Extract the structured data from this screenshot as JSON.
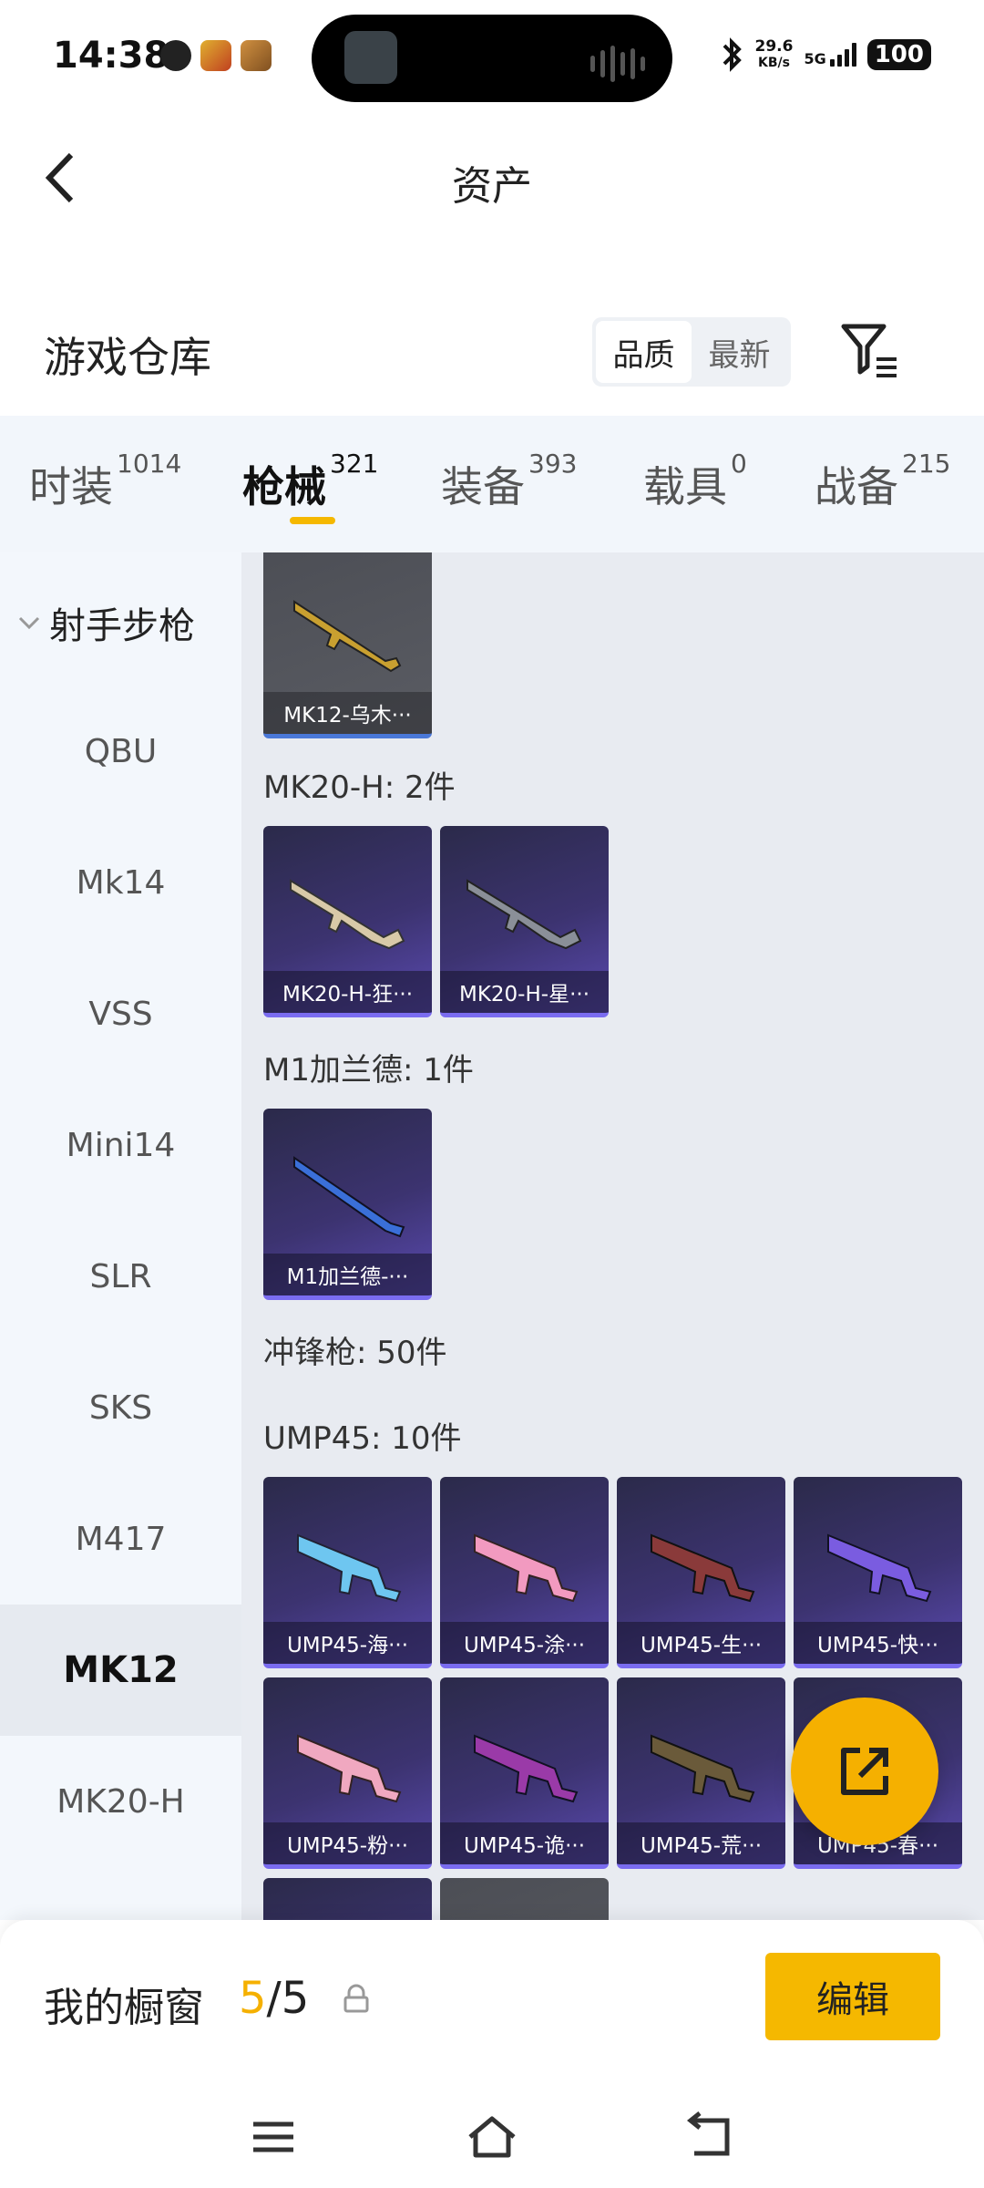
{
  "status_bar": {
    "time": "14:38",
    "net_speed_value": "29.6",
    "net_speed_unit": "KB/s",
    "network": "5G",
    "battery": "100"
  },
  "header": {
    "title": "资产",
    "back_icon": "chevron-left-icon"
  },
  "warehouse": {
    "title": "游戏仓库",
    "sort_options": [
      "品质",
      "最新"
    ],
    "sort_selected": "品质",
    "filter_icon": "filter-icon"
  },
  "tabs": [
    {
      "label": "时装",
      "count": "1014"
    },
    {
      "label": "枪械",
      "count": "321",
      "active": true
    },
    {
      "label": "装备",
      "count": "393"
    },
    {
      "label": "载具",
      "count": "0"
    },
    {
      "label": "战备",
      "count": "215"
    }
  ],
  "sidebar": {
    "group": "射手步枪",
    "items": [
      "QBU",
      "Mk14",
      "VSS",
      "Mini14",
      "SLR",
      "SKS",
      "M417",
      "MK12",
      "MK20-H"
    ],
    "selected": "MK12"
  },
  "content": {
    "top_card": "MK12-乌木···",
    "mk20_header": "MK20-H: 2件",
    "mk20_cards": [
      "MK20-H-狂···",
      "MK20-H-星···"
    ],
    "m1_header": "M1加兰德: 1件",
    "m1_cards": [
      "M1加兰德-···"
    ],
    "smg_header": "冲锋枪: 50件",
    "ump_header": "UMP45: 10件",
    "ump_cards": [
      "UMP45-海···",
      "UMP45-涂···",
      "UMP45-生···",
      "UMP45-快···",
      "UMP45-粉···",
      "UMP45-诡···",
      "UMP45-荒···",
      "UMP45-春···"
    ]
  },
  "fab_icon": "share-external-icon",
  "bottom_bar": {
    "label": "我的橱窗",
    "current": "5",
    "separator": "/",
    "total": "5",
    "lock_icon": "lock-icon",
    "edit_label": "编辑"
  },
  "system_nav": [
    "menu-icon",
    "home-icon",
    "back-icon"
  ],
  "colors": {
    "accent": "#f5b800",
    "card_purple": "#3c3370",
    "card_gray": "#5a5c63",
    "sidebar_bg": "#f3f7fc",
    "content_bg": "#e8ebf1"
  }
}
